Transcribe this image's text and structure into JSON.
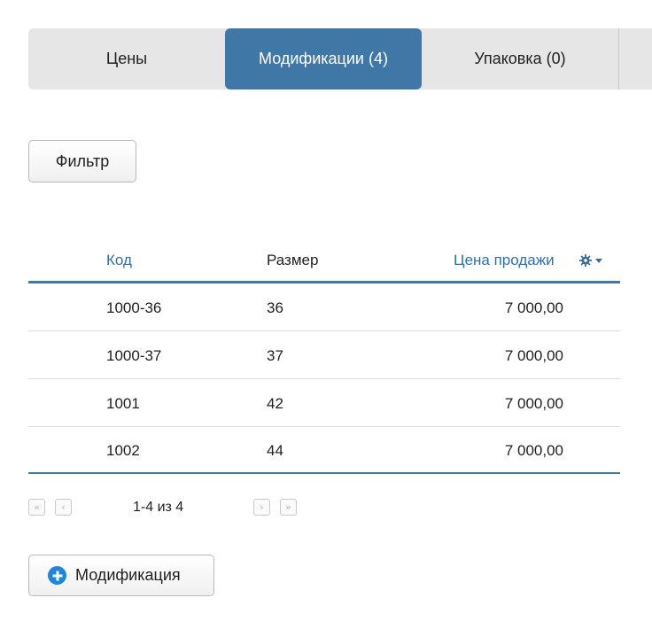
{
  "tabs": [
    {
      "label": "Цены"
    },
    {
      "label": "Модификации (4)"
    },
    {
      "label": "Упаковка (0)"
    }
  ],
  "filter_button": "Фильтр",
  "table": {
    "headers": {
      "code": "Код",
      "size": "Размер",
      "price": "Цена продажи"
    },
    "rows": [
      {
        "code": "1000-36",
        "size": "36",
        "price": "7 000,00"
      },
      {
        "code": "1000-37",
        "size": "37",
        "price": "7 000,00"
      },
      {
        "code": "1001",
        "size": "42",
        "price": "7 000,00"
      },
      {
        "code": "1002",
        "size": "44",
        "price": "7 000,00"
      }
    ]
  },
  "pagination": {
    "info": "1-4 из 4",
    "first_icon": "«",
    "prev_icon": "‹",
    "next_icon": "›",
    "last_icon": "»"
  },
  "add_button": "Модификация",
  "colors": {
    "accent": "#3f78a7",
    "link": "#2f6fae",
    "add_icon": "#1e86d8"
  }
}
